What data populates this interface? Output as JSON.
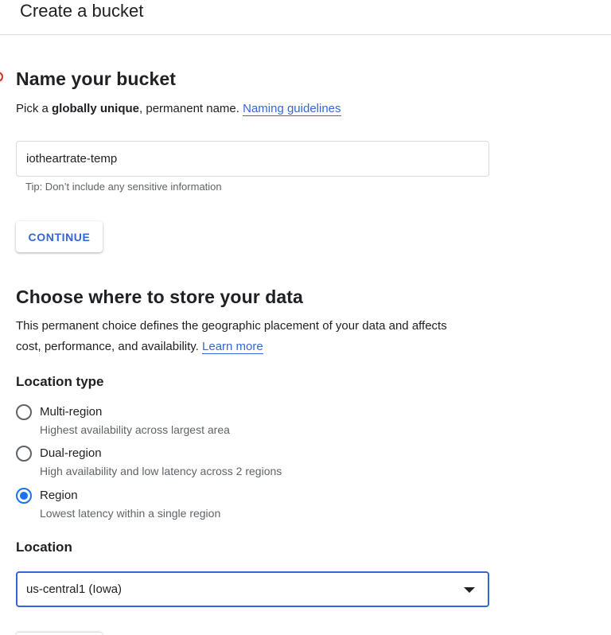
{
  "header": {
    "title": "Create a bucket"
  },
  "name_section": {
    "title": "Name your bucket",
    "desc_prefix": "Pick a ",
    "desc_bold": "globally unique",
    "desc_suffix": ", permanent name. ",
    "desc_link": "Naming guidelines",
    "input_value": "iotheartrate-temp",
    "tip": "Tip: Don’t include any sensitive information",
    "continue_label": "CONTINUE"
  },
  "location_section": {
    "title": "Choose where to store your data",
    "desc_line1": "This permanent choice defines the geographic placement of your data and affects",
    "desc_line2": "cost, performance, and availability. ",
    "desc_link": "Learn more",
    "location_type_label": "Location type",
    "options": [
      {
        "label": "Multi-region",
        "desc": "Highest availability across largest area",
        "checked": false
      },
      {
        "label": "Dual-region",
        "desc": "High availability and low latency across 2 regions",
        "checked": false
      },
      {
        "label": "Region",
        "desc": "Lowest latency within a single region",
        "checked": true
      }
    ],
    "location_label": "Location",
    "location_value": "us-central1 (Iowa)"
  },
  "colors": {
    "accent": "#3367d6",
    "radio_checked": "#1a73e8",
    "error_marker": "#d93025",
    "muted_text": "#5f6368",
    "border": "#dadce0"
  }
}
